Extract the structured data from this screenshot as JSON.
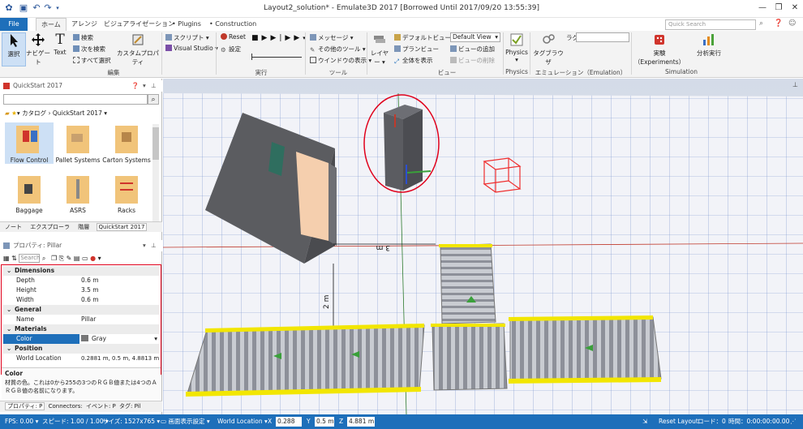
{
  "window": {
    "title": "Layout2_solution* - Emulate3D 2017 [Borrowed Until 2017/09/20 13:55:39]",
    "minimize": "—",
    "restore": "❐",
    "close": "✕"
  },
  "tabs": [
    "File",
    "ホーム",
    "アレンジ",
    "ビジュアライゼーション",
    "Plugins",
    "Construction"
  ],
  "search_placeholder": "Quick Search",
  "ribbon": {
    "select": "選択",
    "navigate": "ナビゲート",
    "text": "Text",
    "search": "検索",
    "find_next": "次を検索",
    "select_all": "すべて選択",
    "custom_prop": "カスタムプロパティ",
    "script": "スクリプト",
    "visual_studio": "Visual Studio",
    "reset": "Reset",
    "settings": "設定",
    "message": "メッセージ",
    "other_tools": "その他のツール",
    "window_display": "ウインドウの表示",
    "layer": "レイヤー",
    "default_view": "デフォルトビュー",
    "plan_view": "プランビュー",
    "show_all": "全体を表示",
    "add_view": "ビューの追加",
    "delete_view": "ビューの削除",
    "view_select": "Default View",
    "physics": "Physics",
    "tag_browser": "タグブラウザ",
    "tag_label": "ラグ",
    "experiments": "実験（Experiments）",
    "analysis": "分析実行",
    "group_edit": "編集",
    "group_run": "実行",
    "group_tools": "ツール",
    "group_view": "ビュー",
    "group_physics": "Physics",
    "group_emulation": "エミュレーション（Emulation）",
    "group_simulation": "Simulation"
  },
  "catalog": {
    "header": "QuickStart 2017",
    "breadcrumb1": "カタログ",
    "breadcrumb2": "QuickStart 2017",
    "items": [
      "Flow Control",
      "Pallet Systems",
      "Carton Systems",
      "Baggage",
      "ASRS",
      "Racks"
    ],
    "tabs": [
      "ノート",
      "エクスプローラ",
      "階層",
      "QuickStart 2017"
    ]
  },
  "properties": {
    "header": "プロパティ: Pillar",
    "search": "Search",
    "rows": [
      {
        "cat": true,
        "k": "Dimensions",
        "v": ""
      },
      {
        "cat": false,
        "k": "Depth",
        "v": "0.6 m"
      },
      {
        "cat": false,
        "k": "Height",
        "v": "3.5 m"
      },
      {
        "cat": false,
        "k": "Width",
        "v": "0.6 m"
      },
      {
        "cat": true,
        "k": "General",
        "v": ""
      },
      {
        "cat": false,
        "k": "Name",
        "v": "Pillar"
      },
      {
        "cat": true,
        "k": "Materials",
        "v": ""
      },
      {
        "cat": false,
        "k": "Color",
        "v": "Gray"
      },
      {
        "cat": true,
        "k": "Position",
        "v": ""
      },
      {
        "cat": false,
        "k": "World Location",
        "v": "0.2881 m, 0.5 m, 4.8813 m"
      }
    ],
    "desc_title": "Color",
    "desc_text": "材質の色。これは0から255の3つのＲＧＢ値または4つのＡＲＧＢ値の名前になります。",
    "tabs": [
      "プロパティ: P",
      "Connectors:",
      "イベント: P",
      "タグ: Pil"
    ]
  },
  "viewport": {
    "dim1": "3 m",
    "dim2": "2 m"
  },
  "status": {
    "fps": "FPS: 0.00",
    "speed": "スピード: 1.00 / 1.00",
    "size": "サイズ: 1527x765",
    "screen": "画面表示設定",
    "world": "World Location",
    "x_label": "X",
    "x": "0.288 m",
    "y_label": "Y",
    "y": "0.5 m",
    "z_label": "Z",
    "z": "4.881 m",
    "reset_layout": "Reset Layout",
    "load": "ロード：0",
    "time": "時間：0:00:00:00.00"
  },
  "colors": {
    "accent": "#1e6fba",
    "selection_highlight": "#e0001b",
    "conveyor_rail": "#f2e600"
  }
}
